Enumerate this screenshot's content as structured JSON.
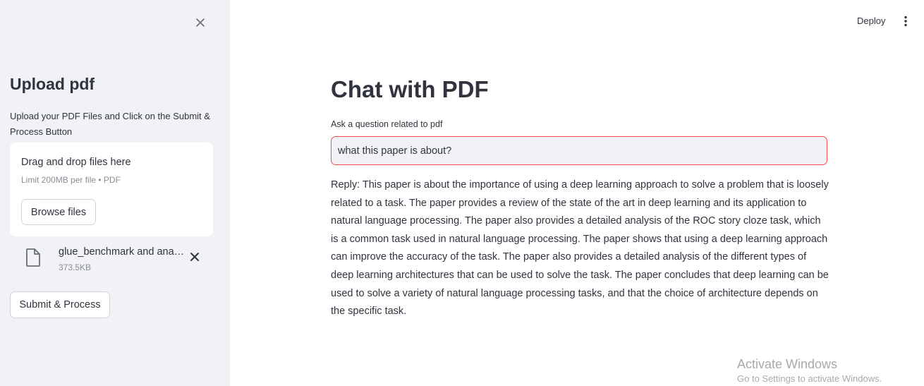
{
  "sidebar": {
    "title": "Upload pdf",
    "description": "Upload your PDF Files and Click on the Submit & Process Button",
    "uploader": {
      "drag_text": "Drag and drop files here",
      "limit_text": "Limit 200MB per file • PDF",
      "browse_label": "Browse files"
    },
    "file": {
      "name": "glue_benchmark and analysis.pdf",
      "size": "373.5KB"
    },
    "submit_label": "Submit & Process"
  },
  "header": {
    "deploy_label": "Deploy"
  },
  "main": {
    "title": "Chat with PDF",
    "question_label": "Ask a question related to pdf",
    "question_value": "what this paper is about?",
    "reply": "Reply: This paper is about the importance of using a deep learning approach to solve a problem that is loosely related to a task. The paper provides a review of the state of the art in deep learning and its application to natural language processing. The paper also provides a detailed analysis of the ROC story cloze task, which is a common task used in natural language processing. The paper shows that using a deep learning approach can improve the accuracy of the task. The paper also provides a detailed analysis of the different types of deep learning architectures that can be used to solve the task. The paper concludes that deep learning can be used to solve a variety of natural language processing tasks, and that the choice of architecture depends on the specific task."
  },
  "watermark": {
    "title": "Activate Windows",
    "subtitle": "Go to Settings to activate Windows."
  },
  "colors": {
    "sidebar_bg": "#f0f2f6",
    "text": "#31333f",
    "focus_border": "#ff4b4b",
    "muted": "#8b8d96"
  },
  "icons": {
    "sidebar_close": "close-icon",
    "file": "file-icon",
    "file_remove": "close-icon",
    "main_menu": "vertical-dots-icon"
  }
}
